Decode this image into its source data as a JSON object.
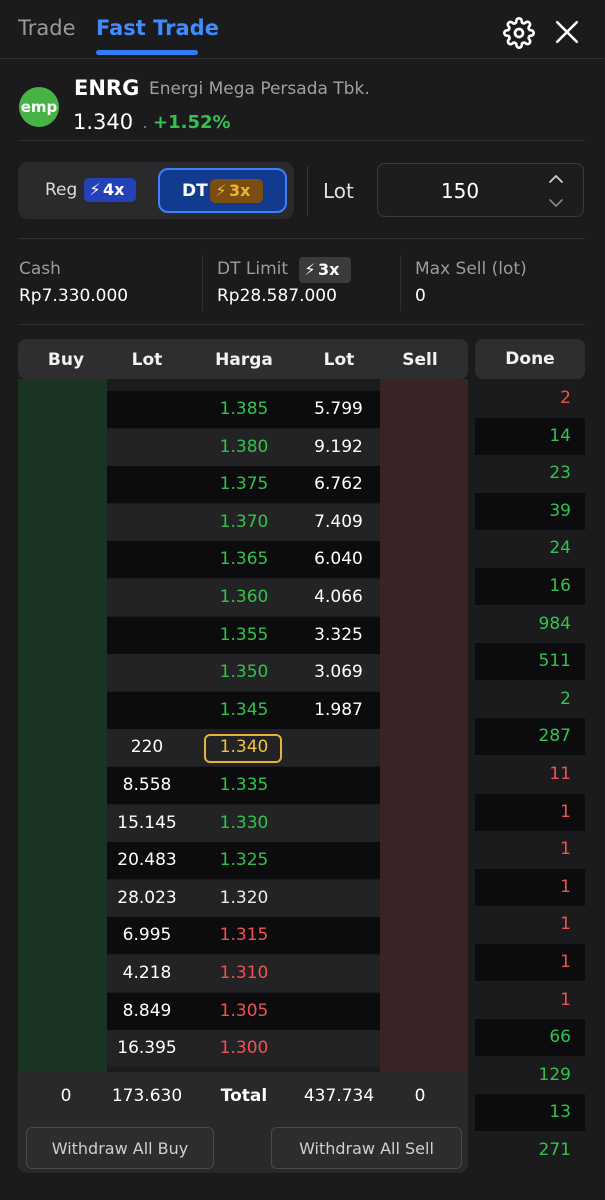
{
  "tabs": {
    "trade": "Trade",
    "fast_trade": "Fast Trade"
  },
  "stock": {
    "logo_text": "emp",
    "symbol": "ENRG",
    "name": "Energi Mega Persada Tbk.",
    "price": "1.340",
    "change": "+1.52%"
  },
  "mode": {
    "reg_label": "Reg",
    "reg_badge": "4x",
    "dt_label": "DT",
    "dt_badge": "3x",
    "lot_label": "Lot",
    "lot_value": "150"
  },
  "info": {
    "cash_label": "Cash",
    "cash_value": "Rp7.330.000",
    "dt_limit_label": "DT Limit",
    "dt_limit_badge": "3x",
    "dt_limit_value": "Rp28.587.000",
    "max_sell_label": "Max Sell (lot)",
    "max_sell_value": "0"
  },
  "orderbook": {
    "headers": {
      "buy": "Buy",
      "lot_bid": "Lot",
      "price": "Harga",
      "lot_offer": "Lot",
      "sell": "Sell",
      "done": "Done"
    },
    "rows": [
      {
        "bid_lot": "",
        "price": "1.385",
        "offer_lot": "5.799",
        "trend": "up"
      },
      {
        "bid_lot": "",
        "price": "1.380",
        "offer_lot": "9.192",
        "trend": "up"
      },
      {
        "bid_lot": "",
        "price": "1.375",
        "offer_lot": "6.762",
        "trend": "up"
      },
      {
        "bid_lot": "",
        "price": "1.370",
        "offer_lot": "7.409",
        "trend": "up"
      },
      {
        "bid_lot": "",
        "price": "1.365",
        "offer_lot": "6.040",
        "trend": "up"
      },
      {
        "bid_lot": "",
        "price": "1.360",
        "offer_lot": "4.066",
        "trend": "up"
      },
      {
        "bid_lot": "",
        "price": "1.355",
        "offer_lot": "3.325",
        "trend": "up"
      },
      {
        "bid_lot": "",
        "price": "1.350",
        "offer_lot": "3.069",
        "trend": "up"
      },
      {
        "bid_lot": "",
        "price": "1.345",
        "offer_lot": "1.987",
        "trend": "up"
      },
      {
        "bid_lot": "220",
        "price": "1.340",
        "offer_lot": "",
        "trend": "current"
      },
      {
        "bid_lot": "8.558",
        "price": "1.335",
        "offer_lot": "",
        "trend": "up"
      },
      {
        "bid_lot": "15.145",
        "price": "1.330",
        "offer_lot": "",
        "trend": "up"
      },
      {
        "bid_lot": "20.483",
        "price": "1.325",
        "offer_lot": "",
        "trend": "up"
      },
      {
        "bid_lot": "28.023",
        "price": "1.320",
        "offer_lot": "",
        "trend": "flat"
      },
      {
        "bid_lot": "6.995",
        "price": "1.315",
        "offer_lot": "",
        "trend": "down"
      },
      {
        "bid_lot": "4.218",
        "price": "1.310",
        "offer_lot": "",
        "trend": "down"
      },
      {
        "bid_lot": "8.849",
        "price": "1.305",
        "offer_lot": "",
        "trend": "down"
      },
      {
        "bid_lot": "16.395",
        "price": "1.300",
        "offer_lot": "",
        "trend": "down"
      }
    ],
    "done": [
      {
        "value": "2",
        "trend": "down"
      },
      {
        "value": "14",
        "trend": "up"
      },
      {
        "value": "23",
        "trend": "up"
      },
      {
        "value": "39",
        "trend": "up"
      },
      {
        "value": "24",
        "trend": "up"
      },
      {
        "value": "16",
        "trend": "up"
      },
      {
        "value": "984",
        "trend": "up"
      },
      {
        "value": "511",
        "trend": "up"
      },
      {
        "value": "2",
        "trend": "up"
      },
      {
        "value": "287",
        "trend": "up"
      },
      {
        "value": "11",
        "trend": "down"
      },
      {
        "value": "1",
        "trend": "down"
      },
      {
        "value": "1",
        "trend": "down"
      },
      {
        "value": "1",
        "trend": "down"
      },
      {
        "value": "1",
        "trend": "down"
      },
      {
        "value": "1",
        "trend": "down"
      },
      {
        "value": "1",
        "trend": "down"
      },
      {
        "value": "66",
        "trend": "up"
      },
      {
        "value": "129",
        "trend": "up"
      },
      {
        "value": "13",
        "trend": "up"
      },
      {
        "value": "271",
        "trend": "up"
      }
    ]
  },
  "totals": {
    "buy_count": "0",
    "bid_total": "173.630",
    "label": "Total",
    "offer_total": "437.734",
    "sell_count": "0"
  },
  "actions": {
    "withdraw_buy": "Withdraw All Buy",
    "withdraw_sell": "Withdraw All Sell"
  },
  "colors": {
    "up": "#33c24d",
    "down": "#ef5350",
    "current": "#f2c043",
    "accent": "#3f8cff"
  },
  "icons": {
    "settings": "gear-icon",
    "close": "close-icon",
    "reg_bolt": "lightning-icon",
    "dt_bolt": "lightning-icon"
  }
}
